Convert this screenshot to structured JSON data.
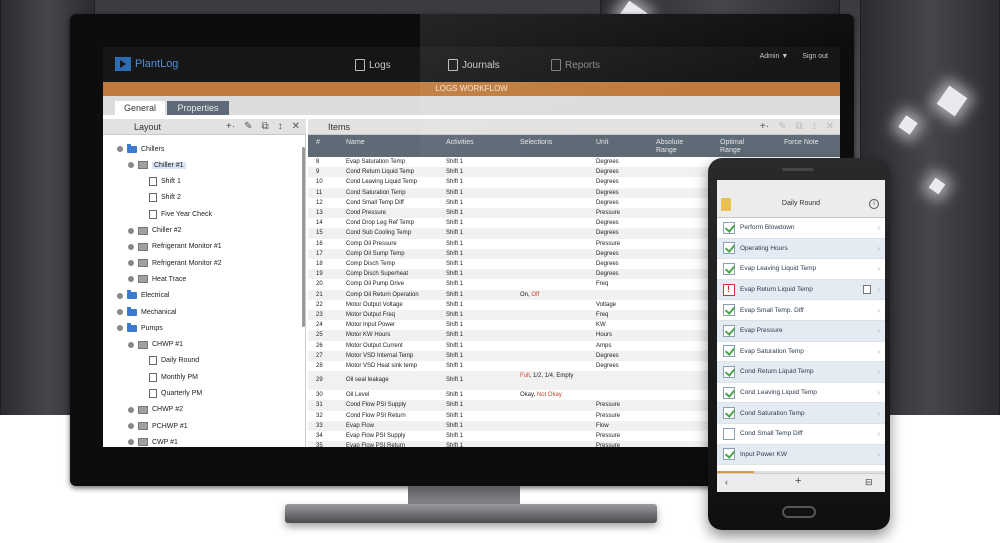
{
  "app": {
    "logo_text": "PlantLog",
    "nav": [
      {
        "label": "Logs",
        "icon": "clipboard-icon"
      },
      {
        "label": "Journals",
        "icon": "notebook-icon"
      },
      {
        "label": "Reports",
        "icon": "report-icon"
      }
    ],
    "user_menu": "Admin ▼",
    "sign_out": "Sign out",
    "workflow_title": "LOGS WORKFLOW",
    "tabs": [
      {
        "label": "General"
      },
      {
        "label": "Properties"
      }
    ],
    "colors": {
      "accent": "#c07a3b",
      "brand": "#2b6cb3",
      "header": "#5f6a77"
    }
  },
  "layout_panel": {
    "title": "Layout",
    "tools": [
      "+·",
      "✎",
      "⧉",
      "↕",
      "✕"
    ],
    "tree": [
      {
        "label": "Chillers",
        "icon": "folder-icon",
        "depth": 0,
        "expander": true
      },
      {
        "label": "Chiller #1",
        "icon": "equipment-icon",
        "depth": 1,
        "expander": true,
        "selected": true
      },
      {
        "label": "Shift 1",
        "icon": "document-icon",
        "depth": 2
      },
      {
        "label": "Shift 2",
        "icon": "document-icon",
        "depth": 2
      },
      {
        "label": "Five Year Check",
        "icon": "document-icon",
        "depth": 2
      },
      {
        "label": "Chiller #2",
        "icon": "equipment-icon",
        "depth": 1,
        "expander": true
      },
      {
        "label": "Refrigerant Monitor #1",
        "icon": "equipment-icon",
        "depth": 1,
        "expander": true
      },
      {
        "label": "Refrigerant Monitor #2",
        "icon": "equipment-icon",
        "depth": 1,
        "expander": true
      },
      {
        "label": "Heat Trace",
        "icon": "equipment-icon",
        "depth": 1,
        "expander": true
      },
      {
        "label": "Electrical",
        "icon": "folder-icon",
        "depth": 0,
        "expander": true
      },
      {
        "label": "Mechanical",
        "icon": "folder-icon",
        "depth": 0,
        "expander": true
      },
      {
        "label": "Pumps",
        "icon": "folder-icon",
        "depth": 0,
        "expander": true
      },
      {
        "label": "CHWP #1",
        "icon": "equipment-icon",
        "depth": 1,
        "expander": true
      },
      {
        "label": "Daily Round",
        "icon": "document-icon",
        "depth": 2
      },
      {
        "label": "Monthly PM",
        "icon": "document-icon",
        "depth": 2
      },
      {
        "label": "Quarterly PM",
        "icon": "document-icon",
        "depth": 2
      },
      {
        "label": "CHWP #2",
        "icon": "equipment-icon",
        "depth": 1,
        "expander": true
      },
      {
        "label": "PCHWP #1",
        "icon": "equipment-icon",
        "depth": 1,
        "expander": true
      },
      {
        "label": "CWP #1",
        "icon": "equipment-icon",
        "depth": 1,
        "expander": true
      }
    ]
  },
  "items_panel": {
    "title": "Items",
    "tools": [
      "+·",
      "✎",
      "⧉",
      "↕",
      "✕"
    ],
    "columns": [
      "#",
      "Name",
      "Activities",
      "Selections",
      "Unit",
      "Absolute Range",
      "Optimal Range",
      "Force Note"
    ],
    "rows": [
      {
        "n": "8",
        "name": "Evap Saturation Temp",
        "act": "Shift 1",
        "sel": "",
        "unit": "Degrees"
      },
      {
        "n": "9",
        "name": "Cond Return Liquid Temp",
        "act": "Shift 1",
        "sel": "",
        "unit": "Degrees"
      },
      {
        "n": "10",
        "name": "Cond Leaving Liquid Temp",
        "act": "Shift 1",
        "sel": "",
        "unit": "Degrees"
      },
      {
        "n": "11",
        "name": "Cond Saturation Temp",
        "act": "Shift 1",
        "sel": "",
        "unit": "Degrees"
      },
      {
        "n": "12",
        "name": "Cond Small Temp Diff",
        "act": "Shift 1",
        "sel": "",
        "unit": "Degrees"
      },
      {
        "n": "13",
        "name": "Cond Pressure",
        "act": "Shift 1",
        "sel": "",
        "unit": "Pressure"
      },
      {
        "n": "14",
        "name": "Cond Drop Leg Ref Temp",
        "act": "Shift 1",
        "sel": "",
        "unit": "Degrees"
      },
      {
        "n": "15",
        "name": "Cond Sub Cooling Temp",
        "act": "Shift 1",
        "sel": "",
        "unit": "Degrees"
      },
      {
        "n": "16",
        "name": "Comp Oil Pressure",
        "act": "Shift 1",
        "sel": "",
        "unit": "Pressure"
      },
      {
        "n": "17",
        "name": "Comp Oil Sump Temp",
        "act": "Shift 1",
        "sel": "",
        "unit": "Degrees"
      },
      {
        "n": "18",
        "name": "Comp Disch Temp",
        "act": "Shift 1",
        "sel": "",
        "unit": "Degrees"
      },
      {
        "n": "19",
        "name": "Comp Disch Superheat",
        "act": "Shift 1",
        "sel": "",
        "unit": "Degrees"
      },
      {
        "n": "20",
        "name": "Comp Oil Pump Drive",
        "act": "Shift 1",
        "sel": "",
        "unit": "Freq"
      },
      {
        "n": "21",
        "name": "Comp Oil Return Operation",
        "act": "Shift 1",
        "sel": "On, ",
        "sel_red": "Off",
        "unit": ""
      },
      {
        "n": "22",
        "name": "Motor Output Voltage",
        "act": "Shift 1",
        "sel": "",
        "unit": "Voltage"
      },
      {
        "n": "23",
        "name": "Motor Output Freq",
        "act": "Shift 1",
        "sel": "",
        "unit": "Freq"
      },
      {
        "n": "24",
        "name": "Motor Input Power",
        "act": "Shift 1",
        "sel": "",
        "unit": "KW"
      },
      {
        "n": "25",
        "name": "Motor KW Hours",
        "act": "Shift 1",
        "sel": "",
        "unit": "Hours"
      },
      {
        "n": "26",
        "name": "Motor Output Current",
        "act": "Shift 1",
        "sel": "",
        "unit": "Amps"
      },
      {
        "n": "27",
        "name": "Motor VSD Internal Temp",
        "act": "Shift 1",
        "sel": "",
        "unit": "Degrees"
      },
      {
        "n": "28",
        "name": "Motor VSD Heat sink temp",
        "act": "Shift 1",
        "sel": "",
        "unit": "Degrees"
      },
      {
        "n": "29",
        "name": "Oil seal leakage",
        "act": "Shift 1",
        "sel_red": "Full",
        "sel": ", 1/2, 1/4, Empty",
        "unit": "",
        "tall": true
      },
      {
        "n": "30",
        "name": "Oil Level",
        "act": "Shift 1",
        "sel": "Okay, ",
        "sel_red": "Not Okay",
        "unit": ""
      },
      {
        "n": "31",
        "name": "Cond Flow PSI Supply",
        "act": "Shift 1",
        "sel": "",
        "unit": "Pressure"
      },
      {
        "n": "32",
        "name": "Cond Flow PSI Return",
        "act": "Shift 1",
        "sel": "",
        "unit": "Pressure"
      },
      {
        "n": "33",
        "name": "Evap Flow",
        "act": "Shift 1",
        "sel": "",
        "unit": "Flow"
      },
      {
        "n": "34",
        "name": "Evap Flow PSI Supply",
        "act": "Shift 1",
        "sel": "",
        "unit": "Pressure"
      },
      {
        "n": "35",
        "name": "Evap Flow PSI Return",
        "act": "Shift 1",
        "sel": "",
        "unit": "Pressure"
      }
    ]
  },
  "mobile": {
    "title": "Daily Round",
    "info": "i",
    "items": [
      {
        "label": "Perform Blowdown",
        "state": "on",
        "shade": false
      },
      {
        "label": "Operating Hours",
        "state": "on",
        "shade": true
      },
      {
        "label": "Evap Leaving Liquid Temp",
        "state": "on",
        "shade": false
      },
      {
        "label": "Evap Return Liquid Temp",
        "state": "flag",
        "shade": true,
        "note": true
      },
      {
        "label": "Evap Small Temp. Diff",
        "state": "on",
        "shade": false
      },
      {
        "label": "Evap Pressure",
        "state": "on",
        "shade": true
      },
      {
        "label": "Evap Saturation Temp",
        "state": "on",
        "shade": false
      },
      {
        "label": "Cond Return Liquid Temp",
        "state": "on",
        "shade": true
      },
      {
        "label": "Cond Leaving Liquid Temp",
        "state": "on",
        "shade": false
      },
      {
        "label": "Cond Saturation Temp",
        "state": "on",
        "shade": true
      },
      {
        "label": "Cond Small Temp Diff",
        "state": "off",
        "shade": false
      },
      {
        "label": "Input Power KW",
        "state": "on",
        "shade": true
      }
    ],
    "progress": 0.22,
    "bottom": {
      "back": "‹",
      "add": "+",
      "save": "⊟"
    }
  }
}
